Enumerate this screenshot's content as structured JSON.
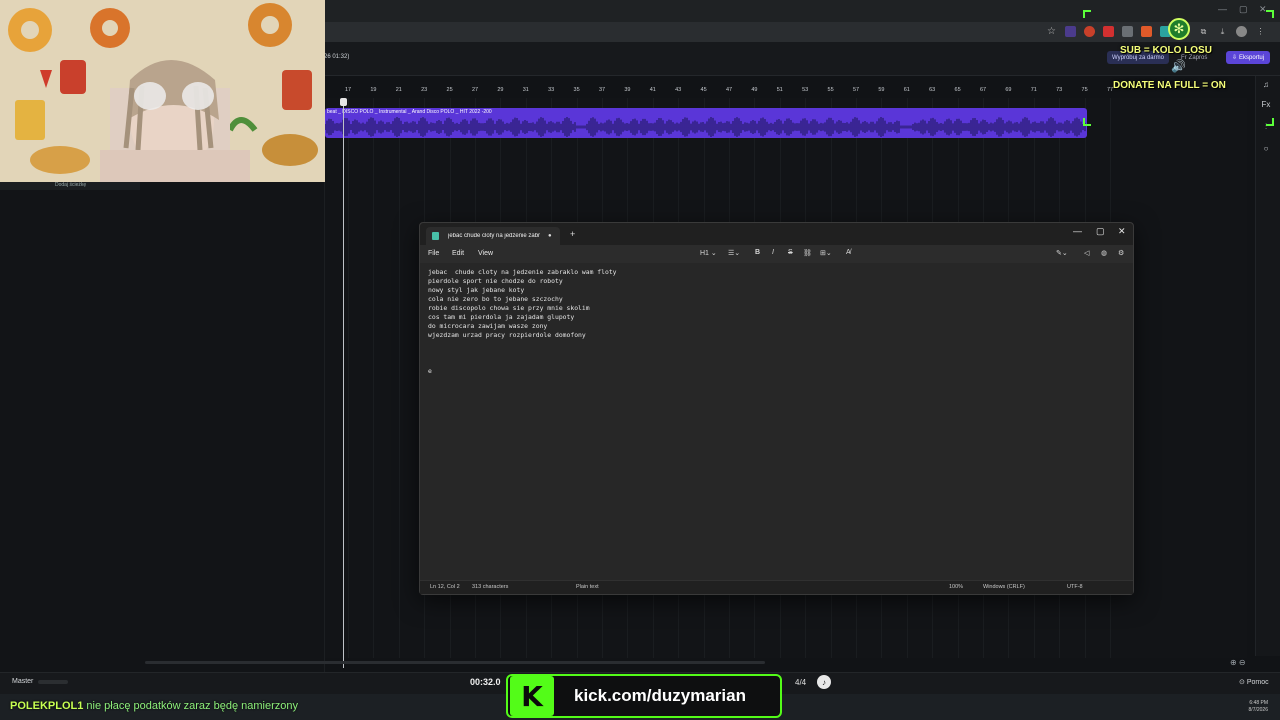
{
  "browser": {
    "ext_icons": [
      "twitch-ext-icon",
      "ext-red-icon",
      "adblock-icon",
      "shield-icon",
      "ext-orange-icon",
      "ext-7tv-icon",
      "wheel-ext-icon",
      "puzzle-icon",
      "download-icon",
      "profile-icon",
      "menu-icon"
    ]
  },
  "daw": {
    "time_small": "26 01:32)",
    "try_free_label": "Wypróbuj za darmo",
    "invite_label": "Zaproś",
    "export_label": "Eksportuj",
    "ruler_ticks": [
      "17",
      "19",
      "21",
      "23",
      "25",
      "27",
      "29",
      "31",
      "33",
      "35",
      "37",
      "39",
      "41",
      "43",
      "45",
      "47",
      "49",
      "51",
      "53",
      "55",
      "57",
      "59",
      "61",
      "63",
      "65",
      "67",
      "69",
      "71",
      "73",
      "75",
      "77"
    ],
    "clip_title": "beat _ DISCO POLO _ Instrumental _ Arand Disco POLO _ HIT 2022 -200",
    "left_panel_item": "Dodaj ścieżkę",
    "master_label": "Master",
    "bottom_time": "00:32.0",
    "time_signature": "4/4",
    "help_label": "Pomoc",
    "accent_color": "#5a36d8"
  },
  "notepad": {
    "tab_title": "jebac  chude cloty na jedzenie zabr",
    "menu": {
      "file": "File",
      "edit": "Edit",
      "view": "View"
    },
    "format": {
      "heading": "H1",
      "bold": "B",
      "italic": "I",
      "strike": "S"
    },
    "lines": [
      "jebac  chude cloty na jedzenie zabraklo wam floty",
      "pierdole sport nie chodze do roboty",
      "nowy styl jak jebane koty",
      "cola nie zero bo to jebane szczochy",
      "robie discopolo chowa sie przy mnie skolim",
      "cos tam mi pierdola ja zajadam glupoty",
      "do microcara zawijam wasze zony",
      "wjezdzam urzad pracy rozpierdole domofony",
      "",
      "",
      "",
      "e"
    ],
    "status": {
      "position": "Ln 12, Col 2",
      "characters": "313 characters",
      "format": "Plain text",
      "zoom": "100%",
      "line_ending": "Windows (CRLF)",
      "encoding": "UTF-8"
    }
  },
  "overlay": {
    "sub_text": "SUB = KOLO LOSU",
    "donate_text": "DONATE NA FULL = ON",
    "chat_user": "POLEKPLOL1",
    "chat_message": " nie płacę podatków zaraz będę namierzony",
    "kick_url": "kick.com/duzymarian",
    "kick_color": "#53fc18"
  },
  "taskbar": {
    "time": "6:48 PM",
    "date": "8/7/2026"
  }
}
